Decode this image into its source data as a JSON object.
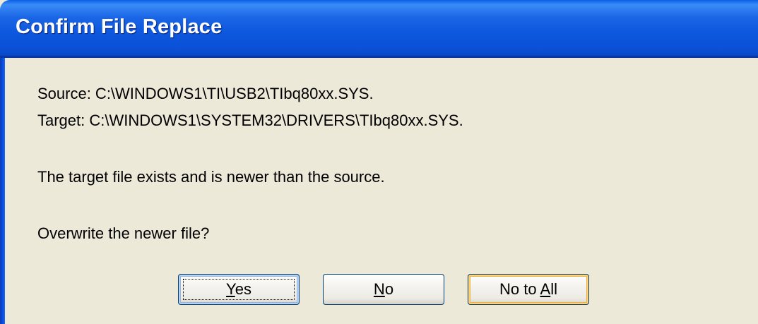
{
  "window": {
    "title": "Confirm File Replace"
  },
  "message": {
    "source_line": "Source: C:\\WINDOWS1\\TI\\USB2\\TIbq80xx.SYS.",
    "target_line": "Target: C:\\WINDOWS1\\SYSTEM32\\DRIVERS\\TIbq80xx.SYS.",
    "status_line": "The target file exists and is newer than the source.",
    "question_line": "Overwrite the newer file?"
  },
  "buttons": {
    "yes": {
      "mnemonic": "Y",
      "rest": "es"
    },
    "no": {
      "mnemonic": "N",
      "rest": "o"
    },
    "no_to_all": {
      "prefix": "No to ",
      "mnemonic": "A",
      "rest": "ll"
    }
  },
  "colors": {
    "titlebar": "#0A52D8",
    "dialog_background": "#ECE9D8",
    "button_border": "#003C74",
    "hover_highlight": "#F7B031"
  }
}
